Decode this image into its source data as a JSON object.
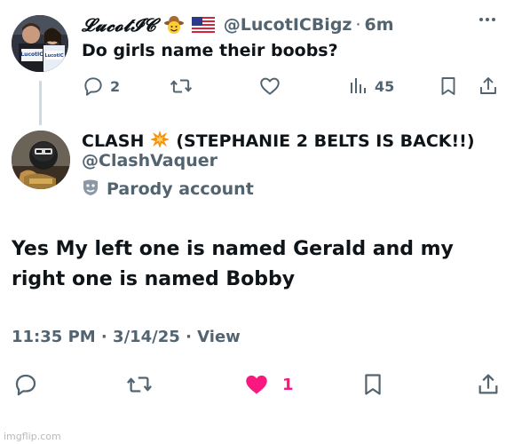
{
  "parent_tweet": {
    "display_name": "𝓛𝓾𝓬𝓸𝓽𝓘𝓒",
    "handle": "@LucotICBigz",
    "separator": "·",
    "time": "6m",
    "text": "Do girls name their boobs?",
    "avatar_text_lines": [
      "LucotIC",
      "Beast"
    ],
    "emojis": [
      "cowboy-face-emoji",
      "us-flag-emoji"
    ],
    "metrics": {
      "replies": "2",
      "reposts": "",
      "likes": "",
      "views": "45"
    }
  },
  "main_tweet": {
    "display_name_part1": "CLASH",
    "display_name_part2": "(STEPHANIE 2 BELTS IS BACK!!)",
    "handle": "@ClashVaquer",
    "parody_label": "Parody account",
    "text": "Yes My left one is named Gerald and my right one is named Bobby",
    "timestamp": "11:35 PM · 3/14/25 · View",
    "metrics": {
      "replies": "",
      "reposts": "",
      "likes": "1"
    },
    "like_active": true
  },
  "colors": {
    "text_primary": "#0f1419",
    "text_secondary": "#536471",
    "like_pink": "#f91880",
    "thread_line": "#cfd9de"
  },
  "watermark": "imgflip.com"
}
